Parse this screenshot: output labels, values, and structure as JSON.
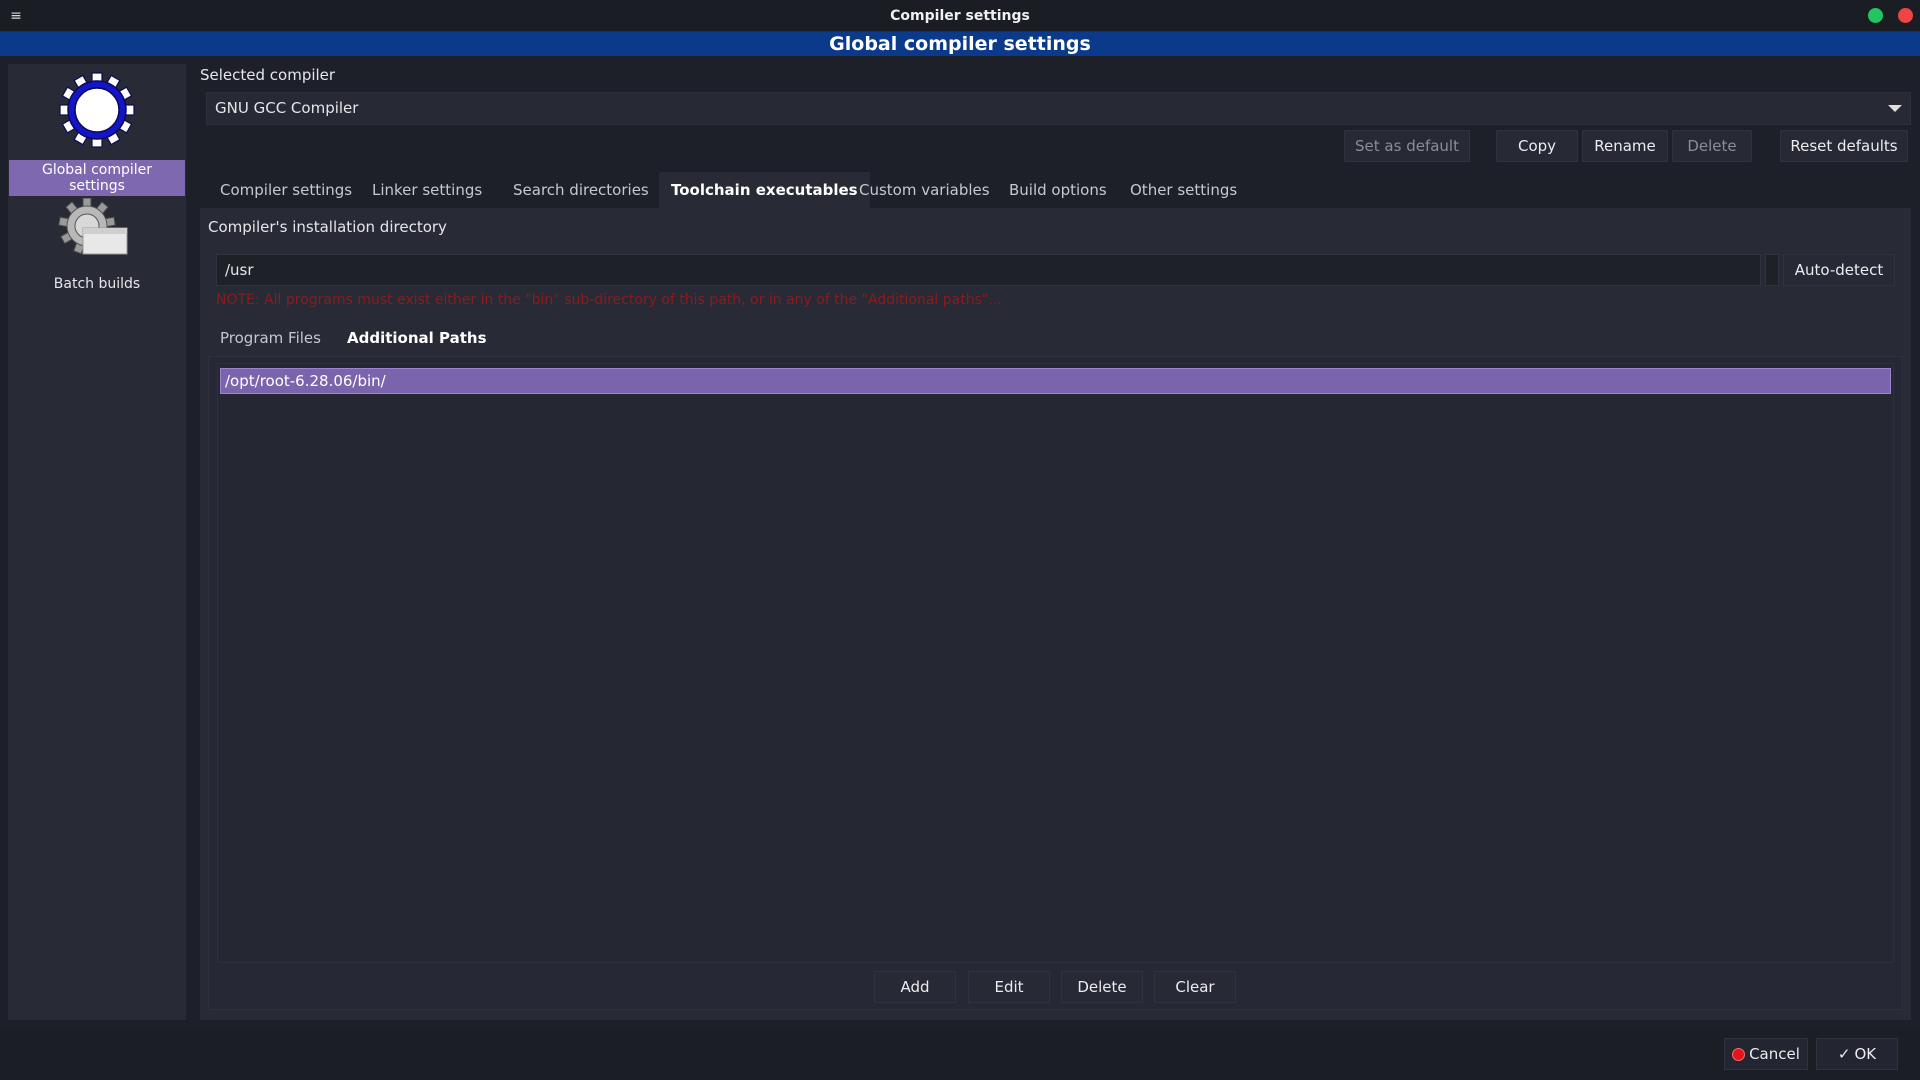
{
  "window": {
    "title": "Compiler settings",
    "banner": "Global compiler settings",
    "menu_glyph": "≡",
    "dots": [
      {
        "name": "maximize-button",
        "color": "#22c55e"
      },
      {
        "name": "close-button",
        "color": "#ef4444"
      }
    ]
  },
  "sidebar": {
    "items": [
      {
        "label": "Global compiler settings",
        "icon": "gear-icon",
        "selected": true
      },
      {
        "label": "Batch builds",
        "icon": "batch-builds-icon",
        "selected": false
      }
    ]
  },
  "compiler": {
    "label": "Selected compiler",
    "value": "GNU GCC Compiler"
  },
  "toolbar": {
    "set_default": "Set as default",
    "copy": "Copy",
    "rename": "Rename",
    "delete": "Delete",
    "reset": "Reset defaults"
  },
  "tabs": [
    "Compiler settings",
    "Linker settings",
    "Search directories",
    "Toolchain executables",
    "Custom variables",
    "Build options",
    "Other settings"
  ],
  "active_tab": "Toolchain executables",
  "installation": {
    "label": "Compiler's installation directory",
    "value": "/usr",
    "auto_detect": "Auto-detect",
    "note": "NOTE: All programs must exist either in the \"bin\" sub-directory of this path, or in any of the \"Additional paths\"..."
  },
  "inner_tabs": [
    "Program Files",
    "Additional Paths"
  ],
  "active_inner_tab": "Additional Paths",
  "paths": [
    "/opt/root-6.28.06/bin/"
  ],
  "path_buttons": {
    "add": "Add",
    "edit": "Edit",
    "delete": "Delete",
    "clear": "Clear"
  },
  "footer": {
    "cancel": "Cancel",
    "ok": "OK"
  },
  "colors": {
    "accent": "#7e68b0",
    "banner": "#0b3a8a",
    "note": "#8a1c1c"
  }
}
